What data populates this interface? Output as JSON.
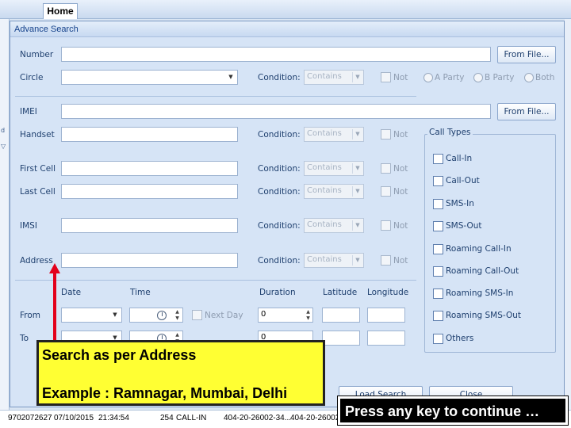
{
  "background": {
    "home_tab": "Home",
    "left_ticks": [
      "d",
      "▽"
    ],
    "row": [
      "9702072627",
      "07/10/2015",
      "21:34:54",
      "254",
      "CALL-IN",
      "404-20-26002-34...",
      "404-20-26002"
    ]
  },
  "dialog": {
    "title": "Advance Search",
    "number_label": "Number",
    "circle_label": "Circle",
    "imei_label": "IMEI",
    "handset_label": "Handset",
    "first_cell_label": "First Cell",
    "last_cell_label": "Last Cell",
    "imsi_label": "IMSI",
    "address_label": "Address",
    "condition_label": "Condition:",
    "condition_value": "Contains",
    "not_label": "Not",
    "from_file_label": "From File...",
    "party_options": [
      "A Party",
      "B Party",
      "Both"
    ],
    "date_label": "Date",
    "time_label": "Time",
    "duration_label": "Duration",
    "latitude_label": "Latitude",
    "longitude_label": "Longitude",
    "from_label": "From",
    "to_label": "To",
    "next_day_label": "Next Day",
    "duration_from_value": "0",
    "duration_to_value": "0",
    "call_types_title": "Call Types",
    "call_types": [
      "Call-In",
      "Call-Out",
      "SMS-In",
      "SMS-Out",
      "Roaming Call-In",
      "Roaming Call-Out",
      "Roaming SMS-In",
      "Roaming SMS-Out",
      "Others"
    ],
    "load_search_label": "Load Search",
    "close_label": "Close"
  },
  "callout": {
    "line1": "Search as per Address",
    "line2": "Example : Ramnagar, Mumbai, Delhi"
  },
  "press_key": "Press any key to continue …",
  "colors": {
    "callout_bg": "#ffff33",
    "arrow": "#e3001b",
    "dialog_bg": "#d6e4f6"
  }
}
